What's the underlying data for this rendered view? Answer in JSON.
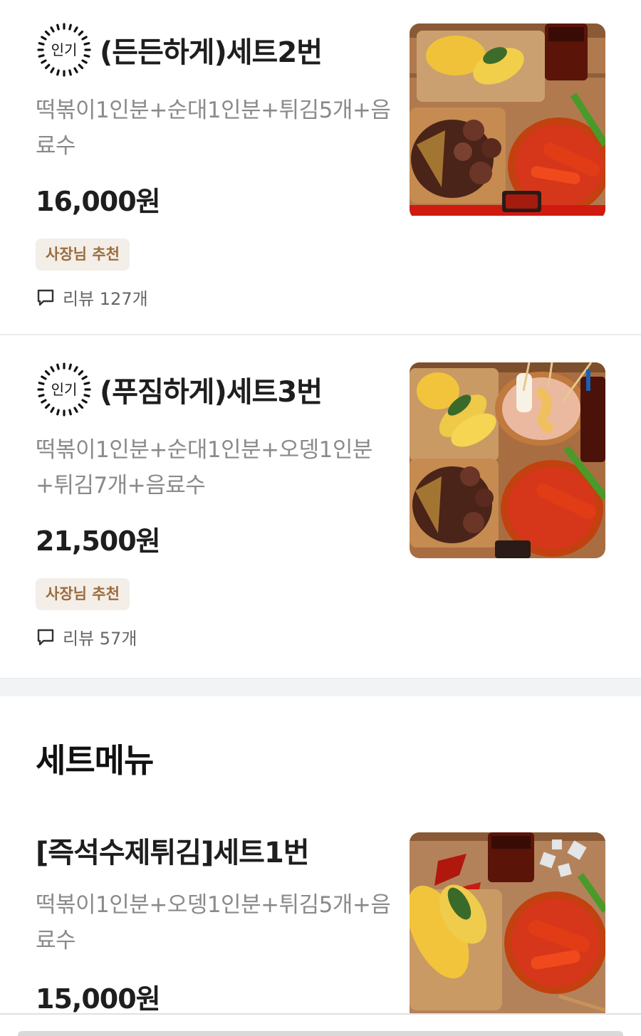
{
  "items": [
    {
      "badge": "인기",
      "title": "(든든하게)세트2번",
      "desc": "떡볶이1인분+순대1인분+튀김5개+음료수",
      "price": "16,000원",
      "owner_badge": "사장님 추천",
      "review": "리뷰 127개"
    },
    {
      "badge": "인기",
      "title": "(푸짐하게)세트3번",
      "desc": "떡볶이1인분+순대1인분+오뎅1인분+튀김7개+음료수",
      "price": "21,500원",
      "owner_badge": "사장님 추천",
      "review": "리뷰 57개"
    }
  ],
  "section": {
    "title": "세트메뉴"
  },
  "set_item": {
    "title": "[즉석수제튀김]세트1번",
    "desc": "떡볶이1인분+오뎅1인분+튀김5개+음료수",
    "price": "15,000원"
  },
  "icons": {
    "popular": "sunburst-popular-icon",
    "review": "speech-bubble-icon"
  },
  "colors": {
    "owner_badge_bg": "#f3eee7",
    "owner_badge_text": "#9b6c3e",
    "desc_text": "#8a8a8a",
    "divider": "#ececec"
  }
}
